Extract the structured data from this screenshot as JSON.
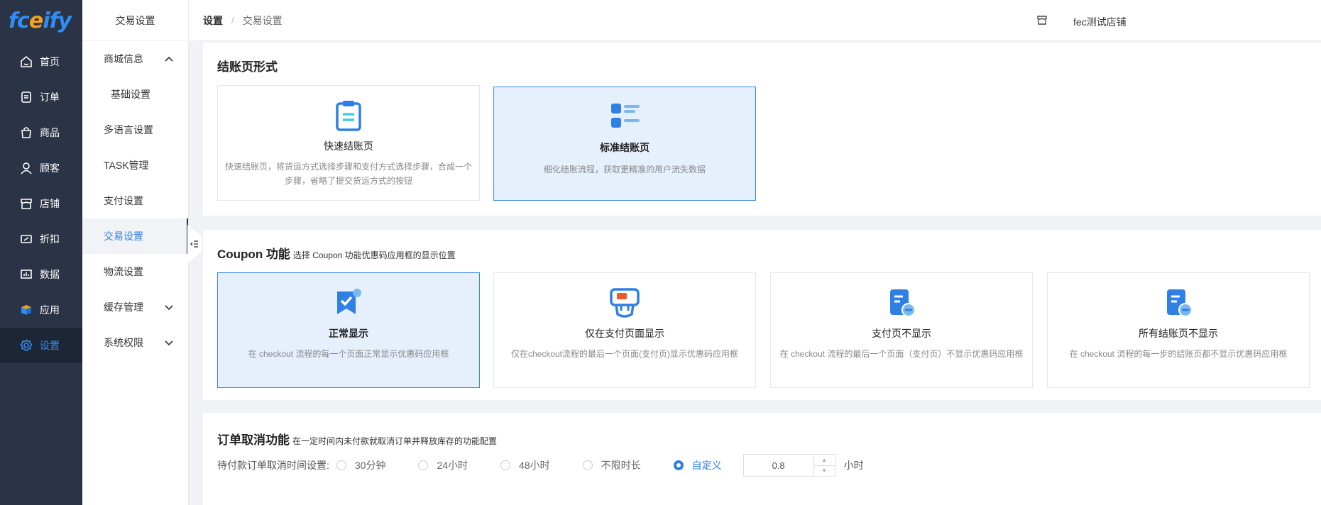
{
  "app": {
    "logo_text_a": "fc",
    "logo_text_b": "ify",
    "logo_e": "e"
  },
  "sidebar": {
    "items": [
      {
        "label": "首页",
        "icon": "home-icon"
      },
      {
        "label": "订单",
        "icon": "order-icon"
      },
      {
        "label": "商品",
        "icon": "bag-icon"
      },
      {
        "label": "顾客",
        "icon": "user-icon"
      },
      {
        "label": "店铺",
        "icon": "store-icon"
      },
      {
        "label": "折扣",
        "icon": "discount-icon"
      },
      {
        "label": "数据",
        "icon": "chart-icon"
      },
      {
        "label": "应用",
        "icon": "app-cube-icon"
      },
      {
        "label": "设置",
        "icon": "gear-icon",
        "active": true
      }
    ]
  },
  "subnav": {
    "title": "交易设置",
    "items": [
      {
        "label": "商城信息"
      },
      {
        "label": "基础设置"
      },
      {
        "label": "多语言设置"
      },
      {
        "label": "TASK管理"
      },
      {
        "label": "支付设置"
      },
      {
        "label": "交易设置",
        "active": true
      },
      {
        "label": "物流设置"
      },
      {
        "label": "缓存管理"
      },
      {
        "label": "系统权限"
      }
    ]
  },
  "header": {
    "breadcrumb_root": "设置",
    "breadcrumb_sep": "/",
    "breadcrumb_current": "交易设置",
    "store_name": "fec测试店铺"
  },
  "checkout": {
    "title": "结账页形式",
    "options": [
      {
        "title": "快速结账页",
        "desc": "快速结账页，将货运方式选择步骤和支付方式选择步骤，合成一个步骤，省略了提交货运方式的按钮",
        "selected": false
      },
      {
        "title": "标准结账页",
        "desc": "细化结账流程，获取更精准的用户流失数据",
        "selected": true
      }
    ]
  },
  "coupon": {
    "title": "Coupon 功能",
    "subtitle": "选择 Coupon 功能优惠码应用框的显示位置",
    "options": [
      {
        "title": "正常显示",
        "desc": "在 checkout 流程的每一个页面正常显示优惠码应用框",
        "selected": true
      },
      {
        "title": "仅在支付页面显示",
        "desc": "仅在checkout流程的最后一个页面(支付页)显示优惠码应用框",
        "selected": false
      },
      {
        "title": "支付页不显示",
        "desc": "在 checkout 流程的最后一个页面（支付页）不显示优惠码应用框",
        "selected": false
      },
      {
        "title": "所有结账页不显示",
        "desc": "在 checkout 流程的每一步的结账页都不显示优惠码应用框",
        "selected": false
      }
    ]
  },
  "cancel": {
    "title": "订单取消功能",
    "subtitle": "在一定时间内未付款就取消订单并释放库存的功能配置",
    "label": "待付款订单取消时间设置:",
    "options": [
      "30分钟",
      "24小时",
      "48小时",
      "不限时长",
      "自定义"
    ],
    "selected_index": 4,
    "custom_value": "0.8",
    "unit": "小时"
  },
  "colors": {
    "sidebar_bg": "#2a3446",
    "accent": "#2f7fe5",
    "selected_card_bg": "#e6f0fd"
  }
}
